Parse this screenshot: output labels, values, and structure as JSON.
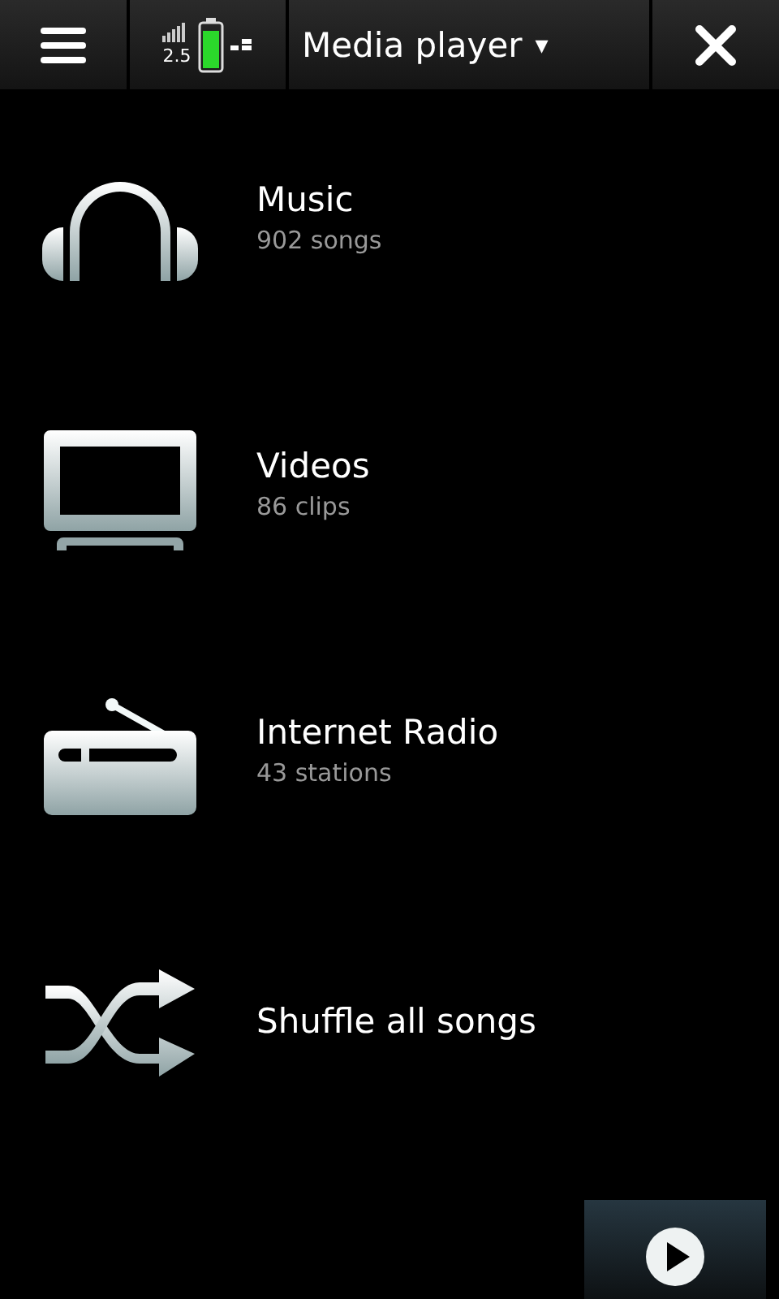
{
  "status": {
    "network": "2.5"
  },
  "title_bar": {
    "title": "Media player",
    "dropdown": "▾"
  },
  "items": [
    {
      "kind": "music",
      "title": "Music",
      "subtitle": "902 songs"
    },
    {
      "kind": "video",
      "title": "Videos",
      "subtitle": "86 clips"
    },
    {
      "kind": "radio",
      "title": "Internet Radio",
      "subtitle": "43 stations"
    },
    {
      "kind": "shuffle",
      "title": "Shuffle all songs"
    }
  ]
}
